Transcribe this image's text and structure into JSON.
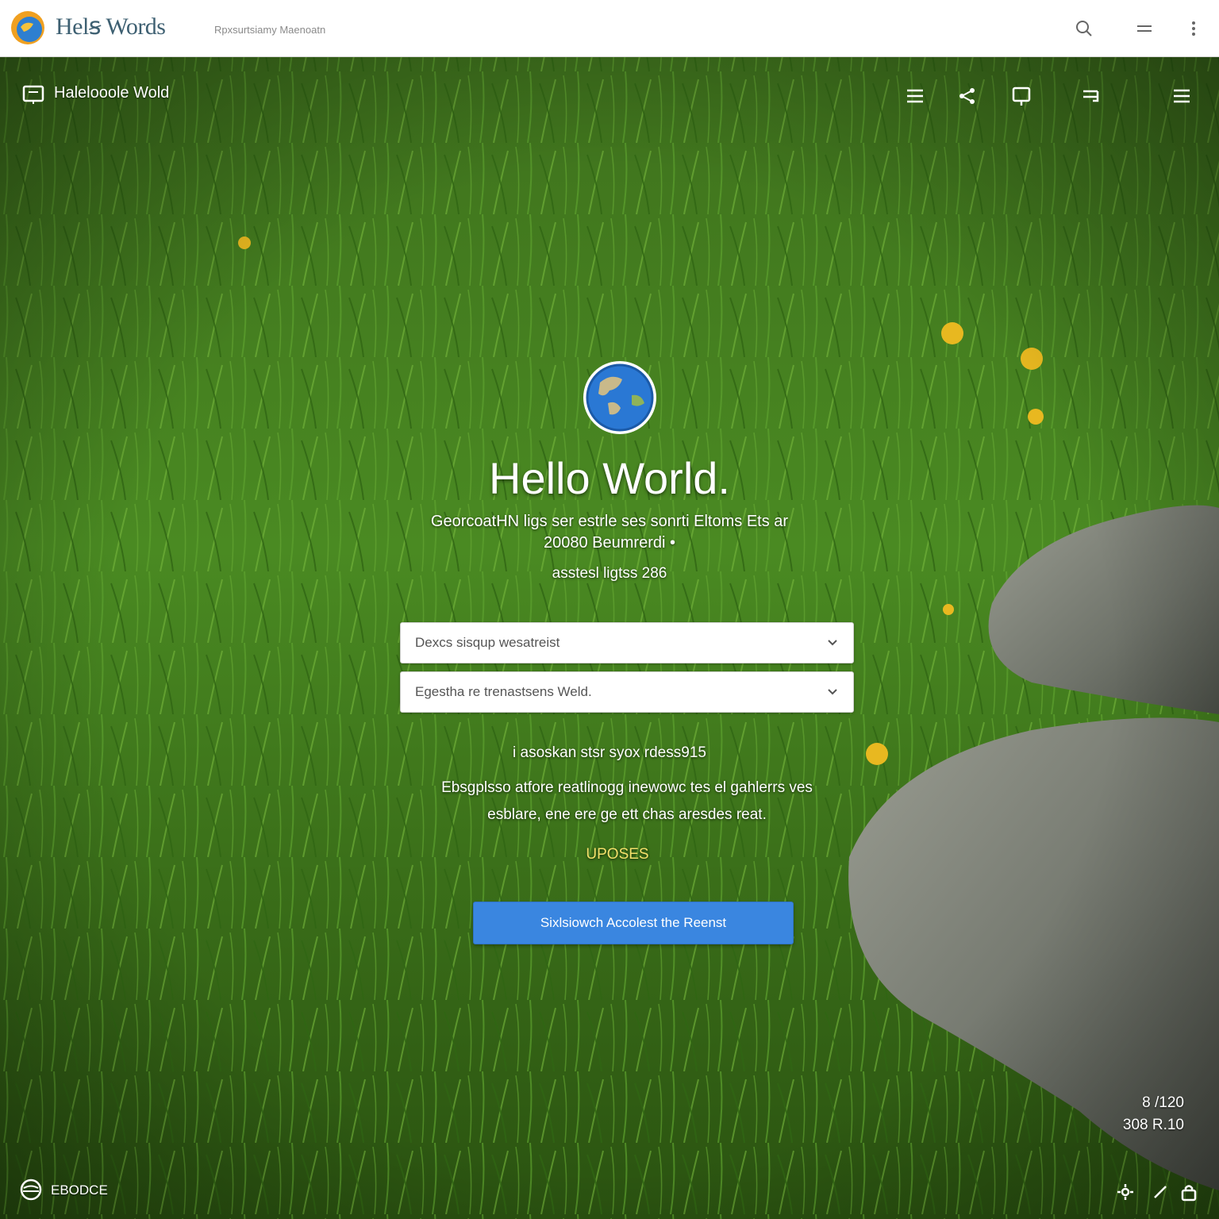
{
  "topbar": {
    "brand": "Helꞩ Words",
    "tagline": "Rpxsurtsiamy Maenoatn",
    "icons": [
      "search-icon",
      "menu-icon",
      "more-vertical-icon"
    ]
  },
  "subnav": {
    "title": "Halelooole Wold",
    "icons": [
      "list-icon",
      "share-icon",
      "chat-icon",
      "reply-icon",
      "hamburger-icon"
    ]
  },
  "hero": {
    "title": "Hello World.",
    "subtitle": "GeorcoatHN ligs ser estrle ses sonrti Eltoms Ets ar 20080 Beumrerdi •",
    "note": "asstesl ligtss 286"
  },
  "form": {
    "select_1": "Dexcs sisqup wesatreist",
    "select_2": "Egestha re trenastsens Weld."
  },
  "description": {
    "heading": "i asoskan stsr syox rdess915",
    "body": "Ebsgplsso atfore reatlinogg inewowc tes el gahlerrs ves esblare, ene ere ge ett chas aresdes reat."
  },
  "link": "UPOSES",
  "cta_label": "Sixlsiowch Accolest the Reenst",
  "footer": {
    "label": "EBODCE",
    "stat_1": "8 /120",
    "stat_2": "308 R.10"
  },
  "colors": {
    "accent": "#3a86e0",
    "link": "#f2e06a",
    "brand_text": "#3e6072"
  }
}
